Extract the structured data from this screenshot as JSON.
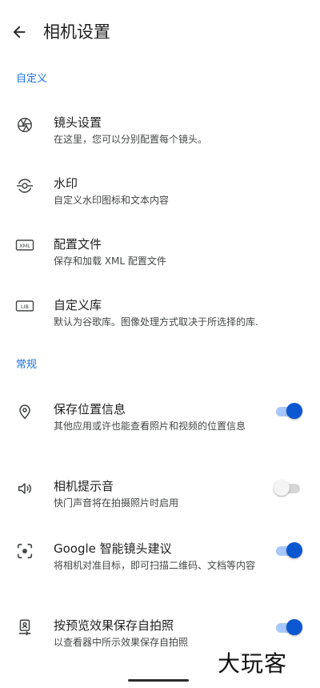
{
  "header": {
    "title": "相机设置",
    "back_icon": "arrow-back-icon"
  },
  "sections": {
    "custom": "自定义",
    "general": "常规"
  },
  "custom_items": [
    {
      "title": "镜头设置",
      "subtitle": "在这里，您可以分别配置每个镜头。",
      "icon": "aperture-icon"
    },
    {
      "title": "水印",
      "subtitle": "自定义水印图标和文本内容",
      "icon": "watermark-icon"
    },
    {
      "title": "配置文件",
      "subtitle": "保存和加载 XML 配置文件",
      "icon": "xml-file-icon",
      "icon_text": "XML"
    },
    {
      "title": "自定义库",
      "subtitle": "默认为谷歌库。图像处理方式取决于所选择的库.",
      "icon": "library-icon",
      "icon_text": "LIB"
    }
  ],
  "general_items": [
    {
      "title": "保存位置信息",
      "subtitle": "其他应用或许也能查看照片和视频的位置信息",
      "icon": "location-pin-icon",
      "enabled": true
    },
    {
      "title": "相机提示音",
      "subtitle": "快门声音将在拍摄照片时启用",
      "icon": "volume-icon",
      "enabled": false
    },
    {
      "title": "Google 智能镜头建议",
      "subtitle": "将相机对准目标，即可扫描二维码、文档等内容",
      "icon": "google-lens-icon",
      "enabled": true
    },
    {
      "title": "按预览效果保存自拍照",
      "subtitle": "以查看器中所示效果保存自拍照",
      "icon": "selfie-icon",
      "enabled": true
    }
  ],
  "watermark_text": "大玩客",
  "colors": {
    "accent": "#1a73e8",
    "toggle_on": "#0b57d0",
    "toggle_track_on": "#a8c7fa"
  }
}
